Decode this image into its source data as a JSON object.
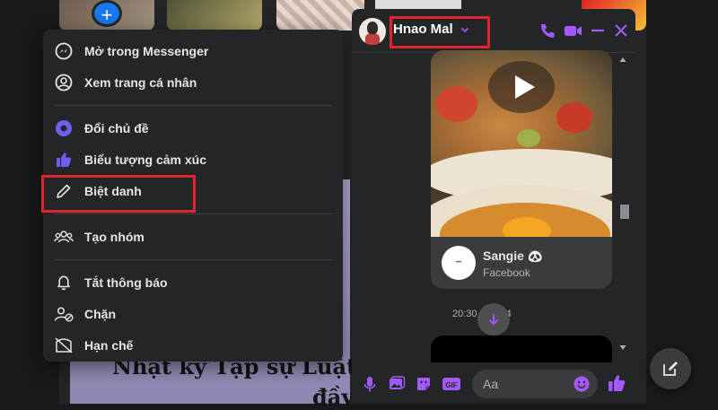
{
  "menu": {
    "items": [
      {
        "label": "Mở trong Messenger",
        "icon": "messenger-icon"
      },
      {
        "label": "Xem trang cá nhân",
        "icon": "profile-icon"
      },
      {
        "label": "Đổi chủ đề",
        "icon": "theme-icon"
      },
      {
        "label": "Biểu tượng cảm xúc",
        "icon": "like-icon"
      },
      {
        "label": "Biệt danh",
        "icon": "pencil-icon"
      },
      {
        "label": "Tạo nhóm",
        "icon": "group-icon"
      },
      {
        "label": "Tắt thông báo",
        "icon": "bell-icon"
      },
      {
        "label": "Chặn",
        "icon": "block-user-icon"
      },
      {
        "label": "Hạn chế",
        "icon": "restrict-icon"
      }
    ]
  },
  "chat": {
    "name": "Hnao Mal",
    "shared_post": {
      "name": "Sangie 🐼",
      "source": "Facebook",
      "avatar_text": "•••"
    },
    "timestamp": "20:30",
    "timestamp_tail": "24",
    "composer": {
      "placeholder": "Aa"
    }
  },
  "post": {
    "title_line1": "Nhật ký Tạp sự Luật",
    "title_line2": "đầy"
  },
  "colors": {
    "accent": "#a259ff",
    "brand_blue": "#1877f2",
    "highlight": "#e3232b",
    "menu_bg": "#242526"
  }
}
